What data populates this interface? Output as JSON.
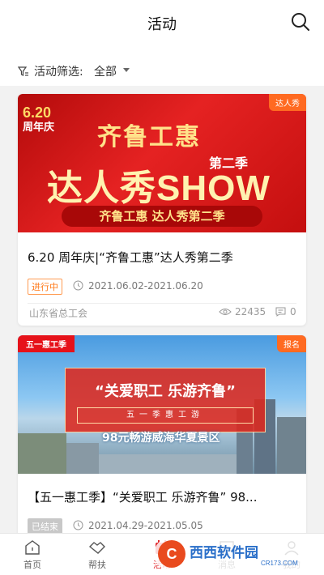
{
  "header": {
    "title": "活动"
  },
  "filter": {
    "label": "活动筛选:",
    "value": "全部"
  },
  "cards": [
    {
      "tag": "达人秀",
      "banner": {
        "date": "6.20",
        "date_sub": "周年庆",
        "top_text": "齐鲁工惠",
        "main_text": "达人秀SHOW",
        "season": "第二季",
        "sub_text": "齐鲁工惠 达人秀第二季"
      },
      "title": "6.20 周年庆|“齐鲁工惠”达人秀第二季",
      "status": "进行中",
      "date_range": "2021.06.02-2021.06.20",
      "org": "山东省总工会",
      "views": "22435",
      "comments": "0"
    },
    {
      "tag": "报名",
      "banner": {
        "ribbon": "五一惠工季",
        "headline": "“关爱职工 乐游齐鲁”",
        "line": "五一季惠工游",
        "caption": "98元畅游威海华夏景区"
      },
      "title": "【五一惠工季】“关爱职工 乐游齐鲁” 98...",
      "status": "已结束",
      "date_range": "2021.04.29-2021.05.05"
    }
  ],
  "tabs": [
    {
      "label": "首页",
      "icon": "home-icon"
    },
    {
      "label": "帮扶",
      "icon": "handshake-icon"
    },
    {
      "label": "活动",
      "icon": "activity-icon",
      "active": true
    },
    {
      "label": "消息",
      "icon": "message-icon"
    },
    {
      "label": "我的",
      "icon": "profile-icon"
    }
  ],
  "watermark": {
    "text": "西西软件园",
    "sub": "CR173.COM"
  },
  "colors": {
    "accent": "#e0262a",
    "tag_orange": "#ff6a21"
  }
}
